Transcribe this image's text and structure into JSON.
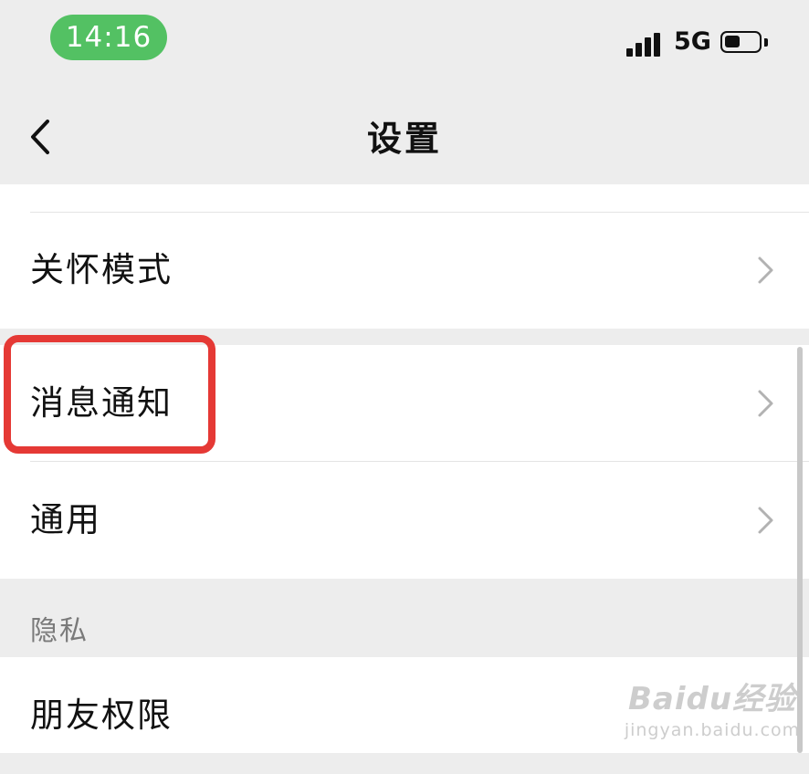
{
  "status_bar": {
    "time": "14:16",
    "network": "5G",
    "time_pill_color": "#53c163"
  },
  "nav": {
    "back_icon": "chevron-left-icon",
    "title": "设置"
  },
  "settings": {
    "group1": [
      {
        "label": "关怀模式",
        "icon": "chevron-right-icon"
      }
    ],
    "group2": [
      {
        "label": "消息通知",
        "icon": "chevron-right-icon",
        "highlighted": true
      },
      {
        "label": "通用",
        "icon": "chevron-right-icon"
      }
    ],
    "privacy_header": "隐私",
    "group3": [
      {
        "label": "朋友权限"
      }
    ]
  },
  "highlight_color": "#e53935",
  "watermark": {
    "main": "Baidu经验",
    "sub": "jingyan.baidu.com"
  }
}
